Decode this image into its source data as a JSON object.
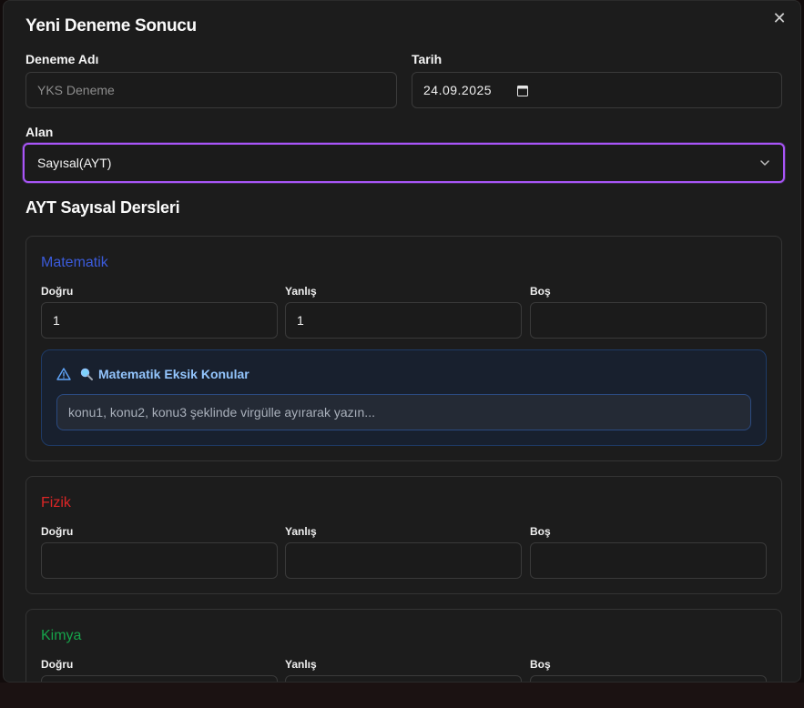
{
  "dialog": {
    "title": "Yeni Deneme Sonucu",
    "close_icon": "close-icon"
  },
  "form": {
    "name_label": "Deneme Adı",
    "name_placeholder": "YKS Deneme",
    "date_label": "Tarih",
    "date_value": "24.09.2025",
    "field_label": "Alan",
    "field_value": "Sayısal(AYT)"
  },
  "section": {
    "title": "AYT Sayısal Dersleri"
  },
  "subjects": [
    {
      "name": "Matematik",
      "color": "#3b5bdb",
      "correct_label": "Doğru",
      "wrong_label": "Yanlış",
      "blank_label": "Boş",
      "correct_value": "1",
      "wrong_value": "1",
      "blank_value": "",
      "missing_title": "Matematik Eksik Konular",
      "missing_placeholder": "konu1, konu2, konu3 şeklinde virgülle ayırarak yazın..."
    },
    {
      "name": "Fizik",
      "color": "#dc2626",
      "correct_label": "Doğru",
      "wrong_label": "Yanlış",
      "blank_label": "Boş",
      "correct_value": "",
      "wrong_value": "",
      "blank_value": ""
    },
    {
      "name": "Kimya",
      "color": "#16a34a",
      "correct_label": "Doğru",
      "wrong_label": "Yanlış",
      "blank_label": "Boş",
      "correct_value": "",
      "wrong_value": "",
      "blank_value": ""
    }
  ],
  "colors": {
    "accent": "#a855f7",
    "info": "#93c5fd"
  }
}
